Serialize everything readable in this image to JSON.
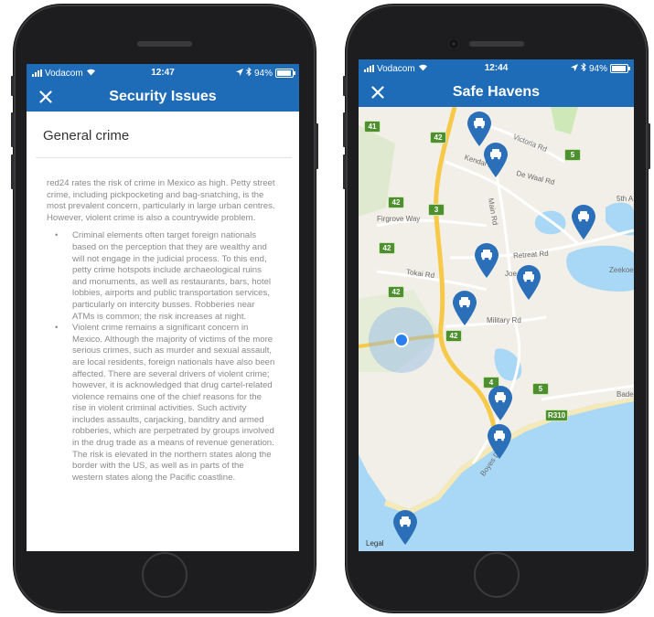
{
  "left_phone": {
    "status": {
      "carrier": "Vodacom",
      "time": "12:47",
      "battery": "94%",
      "battery_level": 0.94
    },
    "nav": {
      "close_icon": "close-icon",
      "title": "Security Issues"
    },
    "heading": "General crime",
    "intro": "red24 rates the risk of crime in Mexico as high. Petty street crime, including pickpocketing and bag-snatching, is the most prevalent concern, particularly in large urban centres. However, violent crime is also a countrywide problem.",
    "bullets": [
      "Criminal elements often target foreign nationals based on the perception that they are wealthy and will not engage in the judicial process. To this end, petty crime hotspots include archaeological ruins and monuments, as well as restaurants, bars, hotel lobbies, airports and public transportation services, particularly on intercity busses. Robberies near ATMs is common; the risk increases at night.",
      "Violent crime remains a significant concern in Mexico. Although the majority of victims of the more serious crimes, such as murder and sexual assault, are local residents, foreign nationals have also been affected. There are several drivers of violent crime; however, it is acknowledged that drug cartel-related violence remains one of the chief reasons for the rise in violent criminal activities. Such activity includes assaults, carjacking, banditry and armed robberies, which are perpetrated by groups involved in the drug trade as a means of revenue generation. The risk is elevated in the northern states along the border with the US, as well as in parts of the western states along the Pacific coastline."
    ]
  },
  "right_phone": {
    "status": {
      "carrier": "Vodacom",
      "time": "12:44",
      "battery": "94%",
      "battery_level": 0.94
    },
    "nav": {
      "close_icon": "close-icon",
      "title": "Safe Havens"
    },
    "map": {
      "legal": "Legal",
      "pin_icon": "taxi-pin-icon",
      "location_icon": "current-location-icon",
      "streets": [
        "Kendal Rd",
        "Victoria Rd",
        "De Waal Rd",
        "Main Rd",
        "Firgrove Way",
        "Retreat Rd",
        "Joe",
        "Tokai Rd",
        "Military Rd",
        "Boyes Dr",
        "Bade",
        "5th A",
        "Zeekoe"
      ],
      "road_badges": [
        "41",
        "42",
        "5",
        "42",
        "3",
        "42",
        "42",
        "42",
        "4",
        "5",
        "R310"
      ],
      "colors": {
        "water": "#a8d8f5",
        "land": "#f2efe8",
        "park": "#cfe8b8",
        "highway": "#f7c948",
        "pin": "#2a6fb8",
        "location": "#2a7ff0"
      }
    }
  }
}
